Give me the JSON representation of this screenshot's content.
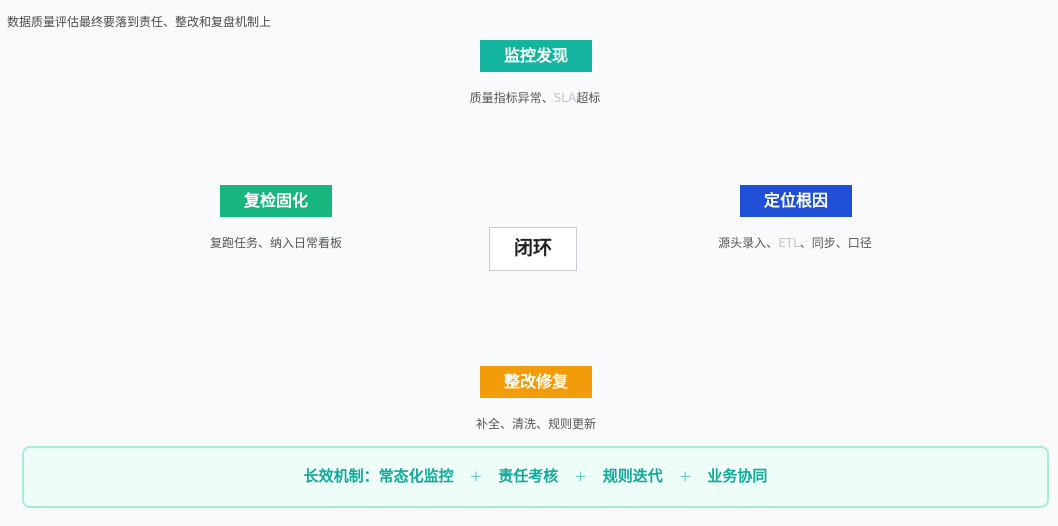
{
  "intro": "数据质量评估最终要落到责任、整改和复盘机制上",
  "center_label": "闭环",
  "nodes": {
    "monitor": {
      "title": "监控发现",
      "color": "#13b5a0",
      "desc": {
        "pre": "质量指标异常、",
        "latin": "SLA",
        "post": "超标"
      }
    },
    "locate": {
      "title": "定位根因",
      "color": "#1f4fd6",
      "desc": {
        "pre": "源头录入、",
        "latin": "ETL",
        "post": "、同步、口径"
      }
    },
    "fix": {
      "title": "整改修复",
      "color": "#f39c0b",
      "desc": {
        "pre": "补全、清洗、规则更新",
        "latin": "",
        "post": ""
      }
    },
    "recheck": {
      "title": "复检固化",
      "color": "#19b57e",
      "desc": {
        "pre": "复跑任务、纳入日常看板",
        "latin": "",
        "post": ""
      }
    }
  },
  "mechanism": {
    "label": "长效机制：",
    "items": [
      "常态化监控",
      "责任考核",
      "规则迭代",
      "业务协同"
    ],
    "separator": "+"
  }
}
